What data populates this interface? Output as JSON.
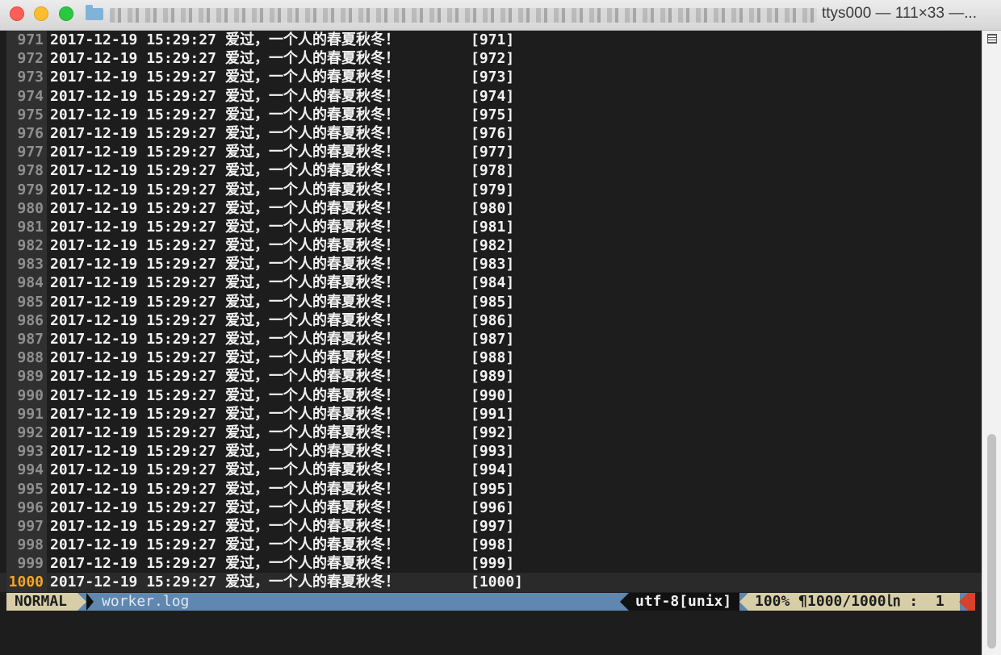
{
  "window": {
    "title_suffix": "ttys000 — 111×33 —..."
  },
  "editor": {
    "lines": [
      {
        "num": "971",
        "timestamp": "2017-12-19 15:29:27",
        "message": "爱过，一个人的春夏秋冬！",
        "index": "[971]"
      },
      {
        "num": "972",
        "timestamp": "2017-12-19 15:29:27",
        "message": "爱过，一个人的春夏秋冬！",
        "index": "[972]"
      },
      {
        "num": "973",
        "timestamp": "2017-12-19 15:29:27",
        "message": "爱过，一个人的春夏秋冬！",
        "index": "[973]"
      },
      {
        "num": "974",
        "timestamp": "2017-12-19 15:29:27",
        "message": "爱过，一个人的春夏秋冬！",
        "index": "[974]"
      },
      {
        "num": "975",
        "timestamp": "2017-12-19 15:29:27",
        "message": "爱过，一个人的春夏秋冬！",
        "index": "[975]"
      },
      {
        "num": "976",
        "timestamp": "2017-12-19 15:29:27",
        "message": "爱过，一个人的春夏秋冬！",
        "index": "[976]"
      },
      {
        "num": "977",
        "timestamp": "2017-12-19 15:29:27",
        "message": "爱过，一个人的春夏秋冬！",
        "index": "[977]"
      },
      {
        "num": "978",
        "timestamp": "2017-12-19 15:29:27",
        "message": "爱过，一个人的春夏秋冬！",
        "index": "[978]"
      },
      {
        "num": "979",
        "timestamp": "2017-12-19 15:29:27",
        "message": "爱过，一个人的春夏秋冬！",
        "index": "[979]"
      },
      {
        "num": "980",
        "timestamp": "2017-12-19 15:29:27",
        "message": "爱过，一个人的春夏秋冬！",
        "index": "[980]"
      },
      {
        "num": "981",
        "timestamp": "2017-12-19 15:29:27",
        "message": "爱过，一个人的春夏秋冬！",
        "index": "[981]"
      },
      {
        "num": "982",
        "timestamp": "2017-12-19 15:29:27",
        "message": "爱过，一个人的春夏秋冬！",
        "index": "[982]"
      },
      {
        "num": "983",
        "timestamp": "2017-12-19 15:29:27",
        "message": "爱过，一个人的春夏秋冬！",
        "index": "[983]"
      },
      {
        "num": "984",
        "timestamp": "2017-12-19 15:29:27",
        "message": "爱过，一个人的春夏秋冬！",
        "index": "[984]"
      },
      {
        "num": "985",
        "timestamp": "2017-12-19 15:29:27",
        "message": "爱过，一个人的春夏秋冬！",
        "index": "[985]"
      },
      {
        "num": "986",
        "timestamp": "2017-12-19 15:29:27",
        "message": "爱过，一个人的春夏秋冬！",
        "index": "[986]"
      },
      {
        "num": "987",
        "timestamp": "2017-12-19 15:29:27",
        "message": "爱过，一个人的春夏秋冬！",
        "index": "[987]"
      },
      {
        "num": "988",
        "timestamp": "2017-12-19 15:29:27",
        "message": "爱过，一个人的春夏秋冬！",
        "index": "[988]"
      },
      {
        "num": "989",
        "timestamp": "2017-12-19 15:29:27",
        "message": "爱过，一个人的春夏秋冬！",
        "index": "[989]"
      },
      {
        "num": "990",
        "timestamp": "2017-12-19 15:29:27",
        "message": "爱过，一个人的春夏秋冬！",
        "index": "[990]"
      },
      {
        "num": "991",
        "timestamp": "2017-12-19 15:29:27",
        "message": "爱过，一个人的春夏秋冬！",
        "index": "[991]"
      },
      {
        "num": "992",
        "timestamp": "2017-12-19 15:29:27",
        "message": "爱过，一个人的春夏秋冬！",
        "index": "[992]"
      },
      {
        "num": "993",
        "timestamp": "2017-12-19 15:29:27",
        "message": "爱过，一个人的春夏秋冬！",
        "index": "[993]"
      },
      {
        "num": "994",
        "timestamp": "2017-12-19 15:29:27",
        "message": "爱过，一个人的春夏秋冬！",
        "index": "[994]"
      },
      {
        "num": "995",
        "timestamp": "2017-12-19 15:29:27",
        "message": "爱过，一个人的春夏秋冬！",
        "index": "[995]"
      },
      {
        "num": "996",
        "timestamp": "2017-12-19 15:29:27",
        "message": "爱过，一个人的春夏秋冬！",
        "index": "[996]"
      },
      {
        "num": "997",
        "timestamp": "2017-12-19 15:29:27",
        "message": "爱过，一个人的春夏秋冬！",
        "index": "[997]"
      },
      {
        "num": "998",
        "timestamp": "2017-12-19 15:29:27",
        "message": "爱过，一个人的春夏秋冬！",
        "index": "[998]"
      },
      {
        "num": "999",
        "timestamp": "2017-12-19 15:29:27",
        "message": "爱过，一个人的春夏秋冬！",
        "index": "[999]"
      },
      {
        "num": "1000",
        "timestamp": "2017-12-19 15:29:27",
        "message": "爱过，一个人的春夏秋冬！",
        "index": "[1000]"
      }
    ],
    "current_line_num": "1000"
  },
  "statusline": {
    "mode": "NORMAL",
    "filename": "worker.log",
    "encoding": "utf-8[unix]",
    "position": "100% ¶1000/1000㏑ :  1"
  },
  "colors": {
    "mode_segment": "#d7cea8",
    "file_segment": "#5f87af",
    "current_line_number": "#f5a623",
    "warning_segment": "#d6422b"
  }
}
